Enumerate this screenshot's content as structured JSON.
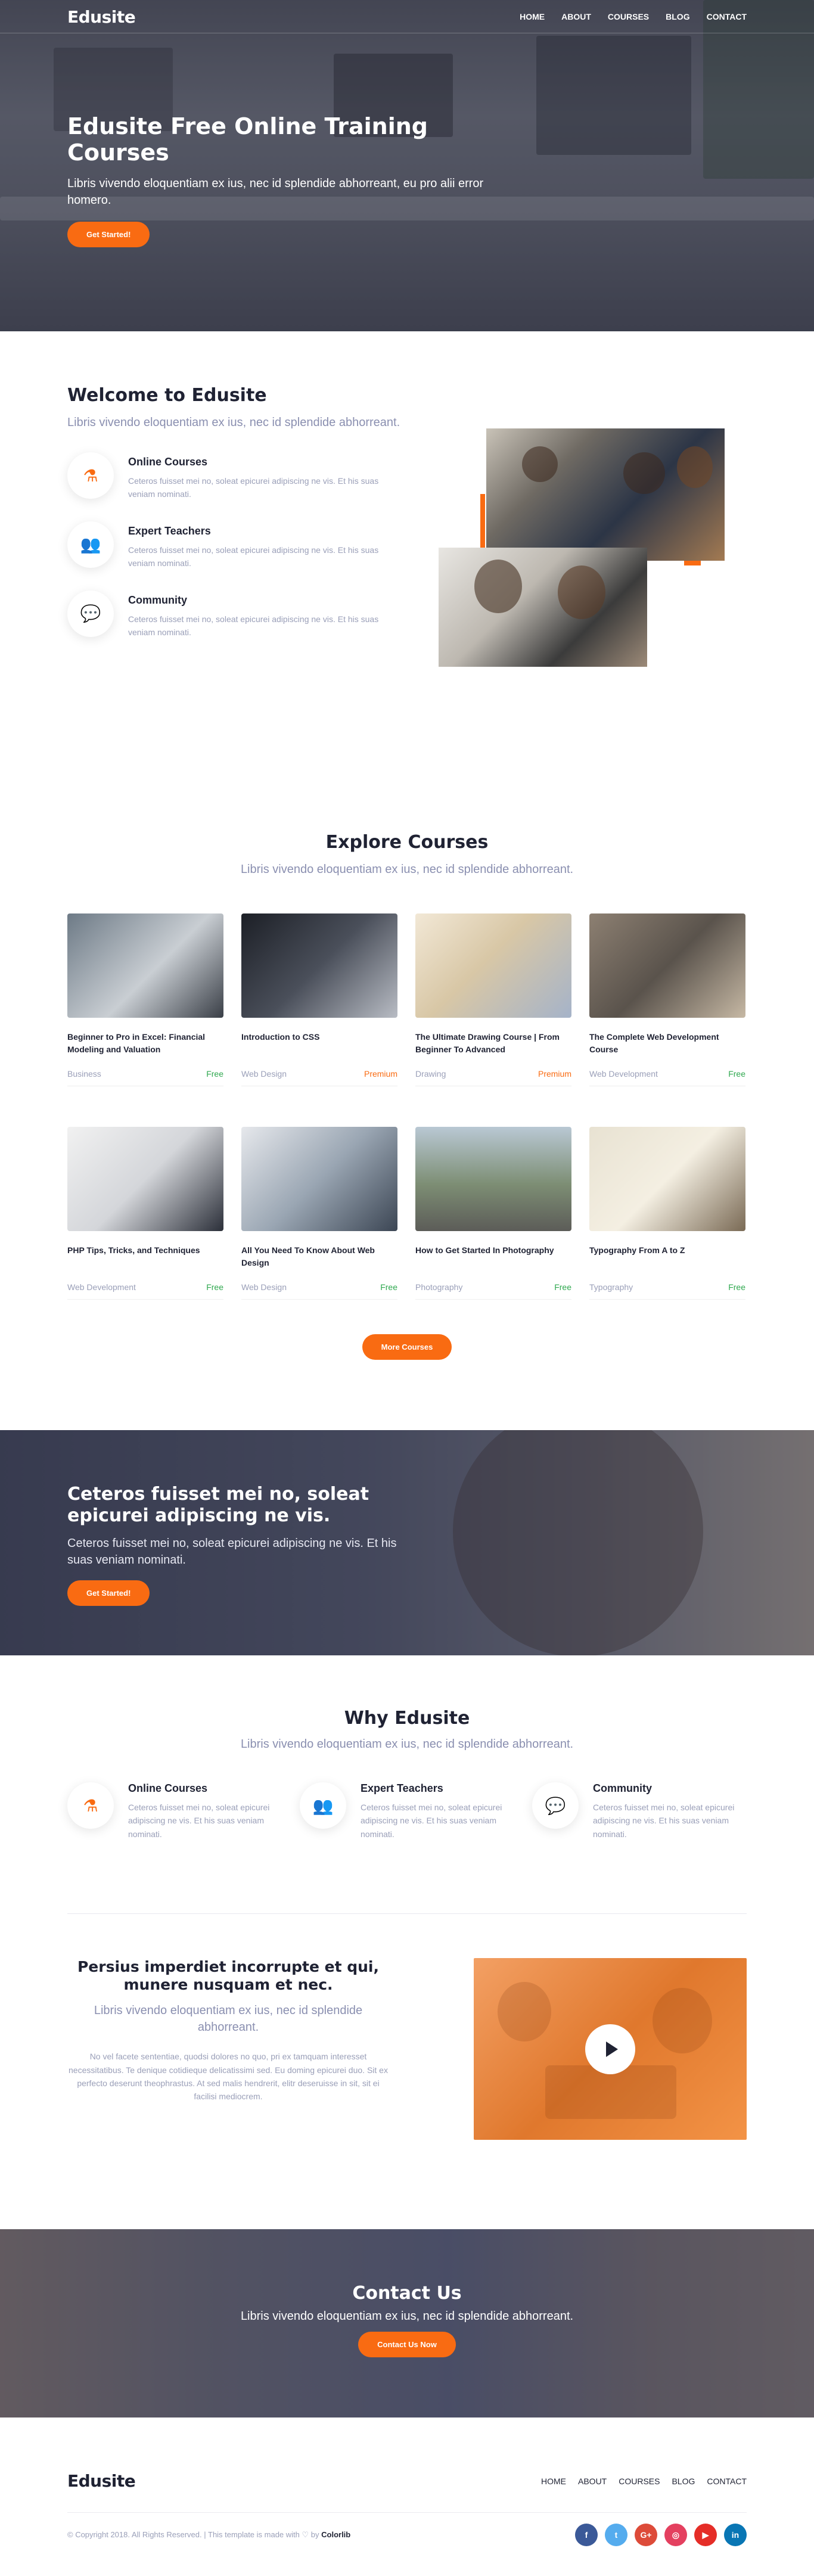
{
  "brand": "Edusite",
  "nav": [
    "HOME",
    "ABOUT",
    "COURSES",
    "BLOG",
    "CONTACT"
  ],
  "hero": {
    "title": "Edusite Free Online Training Courses",
    "subtitle": "Libris vivendo eloquentiam ex ius, nec id splendide abhorreant, eu pro alii error homero.",
    "cta": "Get Started!"
  },
  "welcome": {
    "title": "Welcome to Edusite",
    "lead": "Libris vivendo eloquentiam ex ius, nec id splendide abhorreant.",
    "features": [
      {
        "icon": "flask-icon",
        "title": "Online Courses",
        "text": "Ceteros fuisset mei no, soleat epicurei adipiscing ne vis. Et his suas veniam nominati."
      },
      {
        "icon": "users-icon",
        "title": "Expert Teachers",
        "text": "Ceteros fuisset mei no, soleat epicurei adipiscing ne vis. Et his suas veniam nominati."
      },
      {
        "icon": "chat-icon",
        "title": "Community",
        "text": "Ceteros fuisset mei no, soleat epicurei adipiscing ne vis. Et his suas veniam nominati."
      }
    ]
  },
  "courses": {
    "title": "Explore Courses",
    "lead": "Libris vivendo eloquentiam ex ius, nec id splendide abhorreant.",
    "items": [
      {
        "title": "Beginner to Pro in Excel: Financial Modeling and Valuation",
        "category": "Business",
        "price": "Free",
        "tier": "free",
        "bg": "linear-gradient(135deg,#6d7a86,#c9ced3 55%,#3a3f47)"
      },
      {
        "title": "Introduction to CSS",
        "category": "Web Design",
        "price": "Premium",
        "tier": "premium",
        "bg": "linear-gradient(135deg,#1c1f26,#4a4f5a 50%,#b8bcc4)"
      },
      {
        "title": "The Ultimate Drawing Course | From Beginner To Advanced",
        "category": "Drawing",
        "price": "Premium",
        "tier": "premium",
        "bg": "linear-gradient(135deg,#f2e8d6,#d8c7a6 45%,#a5b3c9)"
      },
      {
        "title": "The Complete Web Development Course",
        "category": "Web Development",
        "price": "Free",
        "tier": "free",
        "bg": "linear-gradient(135deg,#8d8072,#5a534c 50%,#c6b8a4)"
      },
      {
        "title": "PHP Tips, Tricks, and Techniques",
        "category": "Web Development",
        "price": "Free",
        "tier": "free",
        "bg": "linear-gradient(135deg,#f1f1f1,#d4d6da 50%,#2b2f39)"
      },
      {
        "title": "All You Need To Know About Web Design",
        "category": "Web Design",
        "price": "Free",
        "tier": "free",
        "bg": "linear-gradient(135deg,#e6e8ec,#9aa6b3 50%,#3c4654)"
      },
      {
        "title": "How to Get Started In Photography",
        "category": "Photography",
        "price": "Free",
        "tier": "free",
        "bg": "linear-gradient(180deg,#b9c8d4,#7d8e74 55%,#5c5c58)"
      },
      {
        "title": "Typography From A to Z",
        "category": "Typography",
        "price": "Free",
        "tier": "free",
        "bg": "linear-gradient(135deg,#e8e2d2,#f4efe2 50%,#7a6a55)"
      }
    ],
    "more": "More Courses"
  },
  "banner": {
    "title": "Ceteros fuisset mei no, soleat epicurei adipiscing ne vis.",
    "text": "Ceteros fuisset mei no, soleat epicurei adipiscing ne vis. Et his suas veniam nominati.",
    "cta": "Get Started!"
  },
  "why": {
    "title": "Why Edusite",
    "lead": "Libris vivendo eloquentiam ex ius, nec id splendide abhorreant.",
    "features": [
      {
        "icon": "flask-icon",
        "title": "Online Courses",
        "text": "Ceteros fuisset mei no, soleat epicurei adipiscing ne vis. Et his suas veniam nominati."
      },
      {
        "icon": "users-icon",
        "title": "Expert Teachers",
        "text": "Ceteros fuisset mei no, soleat epicurei adipiscing ne vis. Et his suas veniam nominati."
      },
      {
        "icon": "chat-icon",
        "title": "Community",
        "text": "Ceteros fuisset mei no, soleat epicurei adipiscing ne vis. Et his suas veniam nominati."
      }
    ]
  },
  "video": {
    "title": "Persius imperdiet incorrupte et qui, munere nusquam et nec.",
    "lead": "Libris vivendo eloquentiam ex ius, nec id splendide abhorreant.",
    "body": "No vel facete sententiae, quodsi dolores no quo, pri ex tamquam interesset necessitatibus. Te denique cotidieque delicatissimi sed. Eu doming epicurei duo. Sit ex perfecto deserunt theophrastus. At sed malis hendrerit, elitr deseruisse in sit, sit ei facilisi mediocrem."
  },
  "contact": {
    "title": "Contact Us",
    "lead": "Libris vivendo eloquentiam ex ius, nec id splendide abhorreant.",
    "cta": "Contact Us Now"
  },
  "footer": {
    "brand": "Edusite",
    "menu": [
      "HOME",
      "ABOUT",
      "COURSES",
      "BLOG",
      "CONTACT"
    ],
    "copy_prefix": "© Copyright 2018. All Rights Reserved. | This template is made with ♡ by ",
    "copy_author": "Colorlib",
    "social": [
      {
        "icon": "facebook-icon",
        "glyph": "f",
        "color": "#3b5998"
      },
      {
        "icon": "twitter-icon",
        "glyph": "t",
        "color": "#55acee"
      },
      {
        "icon": "google-plus-icon",
        "glyph": "G+",
        "color": "#dd4b39"
      },
      {
        "icon": "instagram-icon",
        "glyph": "◎",
        "color": "#e4405f"
      },
      {
        "icon": "youtube-icon",
        "glyph": "▶",
        "color": "#e52d27"
      },
      {
        "icon": "linkedin-icon",
        "glyph": "in",
        "color": "#0976b4"
      }
    ]
  },
  "colors": {
    "accent": "#f96b12",
    "free": "#2fa84f",
    "heading": "#1f2233",
    "muted": "#9a9fb8"
  }
}
